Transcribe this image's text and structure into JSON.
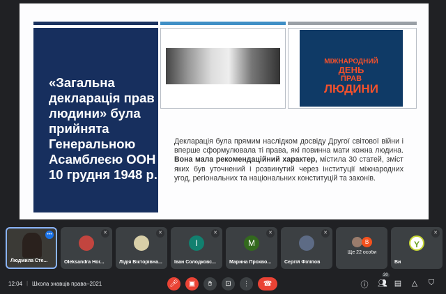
{
  "slide": {
    "bar_colors": [
      "#1b325f",
      "#3f8fc6",
      "#9aa0a6"
    ],
    "title": "«Загальна декларація прав людини» була прийнята Генеральною Асамблеєю ООН 10 грудня 1948 р.",
    "poster_words": [
      "МІЖНАРОДНИЙ",
      "ДЕНЬ",
      "ПРАВ",
      "ЛЮДИНИ"
    ],
    "body_normal_1": "Декларація була прямим наслідком досвіду Другої світової війни і вперше сформулювала ті права, які повинна мати кожна людина. ",
    "body_bold": "Вона мала рекомендаційний характер,",
    "body_normal_2": " містила 30 статей, зміст яких був уточнений і розвинутий через інституції міжнародних угод, регіональних та національних конституцій та законів."
  },
  "participants": [
    {
      "name": "Людмила Сте..."
    },
    {
      "name": "Oleksandra Hor..."
    },
    {
      "name": "Лідія Вікторівна..."
    },
    {
      "name": "Іван Солодковс...",
      "initial": "I",
      "color": "#12806f"
    },
    {
      "name": "Марина Прохво...",
      "initial": "M",
      "color": "#33691e"
    },
    {
      "name": "Сергій Філіпов"
    },
    {
      "name": "Ще 22 особи",
      "initial": "B",
      "color": "#f4511e"
    },
    {
      "name": "Ви"
    }
  ],
  "bottom": {
    "time": "12:04",
    "separator": "|",
    "meeting": "Школа знавців права–2021",
    "participant_count": "30"
  }
}
